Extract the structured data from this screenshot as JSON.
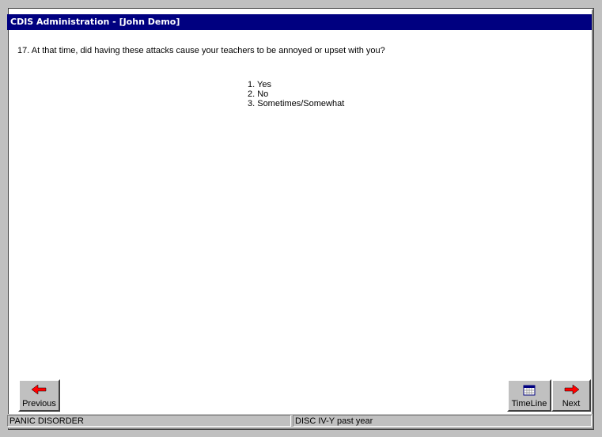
{
  "window": {
    "title": "CDIS Administration - [John Demo]"
  },
  "question": {
    "text": "17. At that time, did having these attacks cause your teachers to be annoyed or upset with you?"
  },
  "answers": [
    "1. Yes",
    "2. No",
    "3. Sometimes/Somewhat"
  ],
  "buttons": {
    "previous": "Previous",
    "timeline": "TimeLine",
    "next": "Next"
  },
  "status": {
    "module": "PANIC DISORDER",
    "version": "DISC IV-Y past year"
  },
  "icons": {
    "previous": "red-left-arrow-icon",
    "timeline": "calendar-icon",
    "next": "red-right-arrow-icon"
  },
  "colors": {
    "titlebar": "#000080",
    "arrow": "#ff0000",
    "face": "#c0c0c0"
  }
}
